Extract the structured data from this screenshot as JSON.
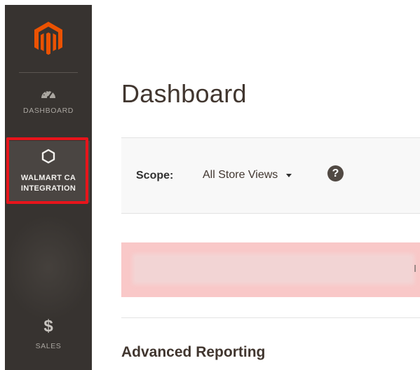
{
  "sidebar": {
    "logo": {
      "icon": "magento-logo-icon",
      "color": "#eb5202"
    },
    "items": [
      {
        "label": "DASHBOARD",
        "icon": "speedometer-icon"
      },
      {
        "label_line1": "WALMART CA",
        "label_line2": "INTEGRATION",
        "icon": "hexagon-icon",
        "active": true,
        "highlight_color": "#e8141b"
      },
      {
        "label": "SALES",
        "icon": "dollar-icon",
        "glyph": "$"
      }
    ]
  },
  "main": {
    "title": "Dashboard",
    "scope": {
      "label": "Scope:",
      "value": "All Store Views",
      "help_glyph": "?"
    },
    "message": {
      "background": "#f9c8c8"
    },
    "section_heading": "Advanced Reporting"
  }
}
